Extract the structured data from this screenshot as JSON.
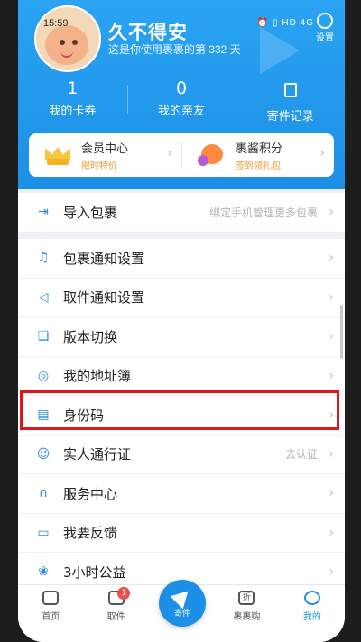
{
  "status": {
    "time": "15:59",
    "icons": "⏰ ▯ HD 4G"
  },
  "profile": {
    "username": "久不得安",
    "days_text": "这是你使用裹裹的第 332 天"
  },
  "settings": {
    "label": "设置"
  },
  "stats": [
    {
      "value": "1",
      "label": "我的卡券"
    },
    {
      "value": "0",
      "label": "我的亲友"
    },
    {
      "label": "寄件记录"
    }
  ],
  "cards": [
    {
      "title": "会员中心",
      "subtitle": "限时特价"
    },
    {
      "title": "裹酱积分",
      "subtitle": "签到领礼包"
    }
  ],
  "import_row": {
    "label": "导入包裹",
    "hint": "绑定手机管理更多包裹"
  },
  "menu": [
    {
      "label": "包裹通知设置",
      "icon": "bell-icon"
    },
    {
      "label": "取件通知设置",
      "icon": "speaker-icon"
    },
    {
      "label": "版本切换",
      "icon": "switch-icon"
    },
    {
      "label": "我的地址簿",
      "icon": "location-icon"
    },
    {
      "label": "身份码",
      "icon": "id-card-icon"
    },
    {
      "label": "实人通行证",
      "icon": "person-icon",
      "hint": "去认证"
    },
    {
      "label": "服务中心",
      "icon": "headset-icon"
    },
    {
      "label": "我要反馈",
      "icon": "feedback-icon"
    },
    {
      "label": "3小时公益",
      "icon": "charity-icon"
    }
  ],
  "tabbar": {
    "home": "首页",
    "pickup": "取件",
    "pickup_badge": "1",
    "send": "寄件",
    "shop": "裹裹购",
    "mine": "我的",
    "shop_icon_text": "折"
  },
  "colors": {
    "primary": "#1c8fe6",
    "highlight": "#e0161d",
    "orange": "#f09a2c"
  }
}
